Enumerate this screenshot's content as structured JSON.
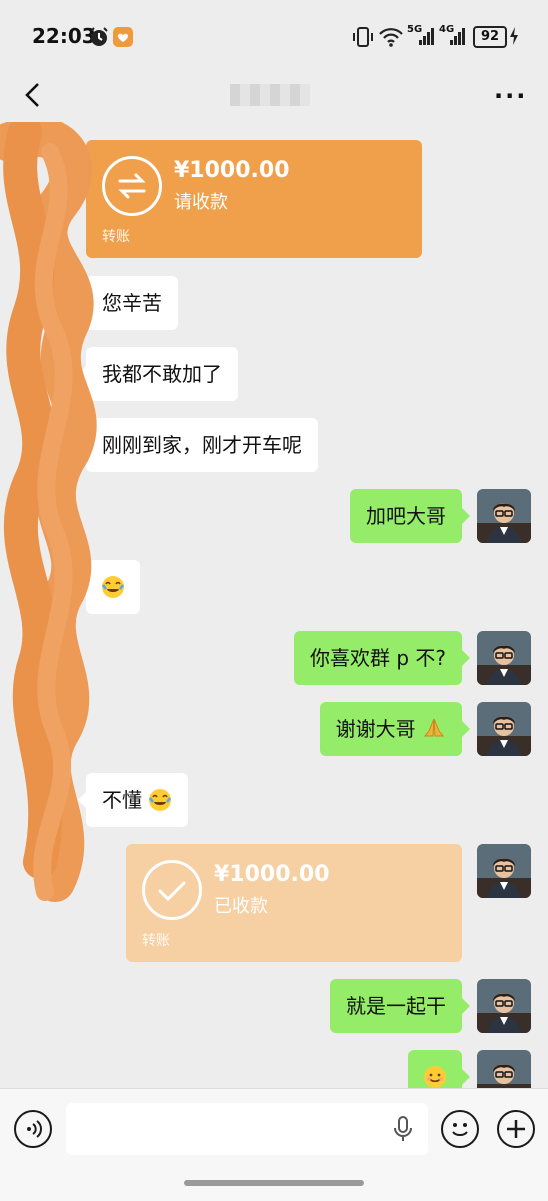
{
  "status_bar": {
    "time": "22:03",
    "network_label": "5G",
    "network_label_2": "4G",
    "battery": "92"
  },
  "header": {
    "back_label": "‹",
    "more_label": "···"
  },
  "messages": [
    {
      "kind": "transfer",
      "side": "in",
      "amount": "¥1000.00",
      "status": "请收款",
      "footer": "转账"
    },
    {
      "kind": "text",
      "side": "in",
      "text": "您辛苦"
    },
    {
      "kind": "text",
      "side": "in",
      "text": "我都不敢加了"
    },
    {
      "kind": "text",
      "side": "in",
      "text": "刚刚到家，刚才开车呢"
    },
    {
      "kind": "text",
      "side": "out",
      "text": "加吧大哥"
    },
    {
      "kind": "emoji",
      "side": "in",
      "emoji": "laugh-cry"
    },
    {
      "kind": "text",
      "side": "out",
      "text": "你喜欢群 p 不?"
    },
    {
      "kind": "text",
      "side": "out",
      "text": "谢谢大哥",
      "emoji": "pray"
    },
    {
      "kind": "text",
      "side": "in",
      "text": "不懂",
      "emoji": "laugh-cry"
    },
    {
      "kind": "transfer",
      "side": "out",
      "amount": "¥1000.00",
      "status": "已收款",
      "footer": "转账"
    },
    {
      "kind": "text",
      "side": "out",
      "text": "就是一起干"
    },
    {
      "kind": "emoji",
      "side": "out",
      "emoji": "smile"
    }
  ],
  "input_bar": {
    "placeholder": ""
  },
  "colors": {
    "outgoing": "#95ec69",
    "incoming": "#ffffff",
    "transfer_pending": "#f0a04b",
    "transfer_received": "#f6cfa2",
    "redaction": "#ec9a55"
  }
}
